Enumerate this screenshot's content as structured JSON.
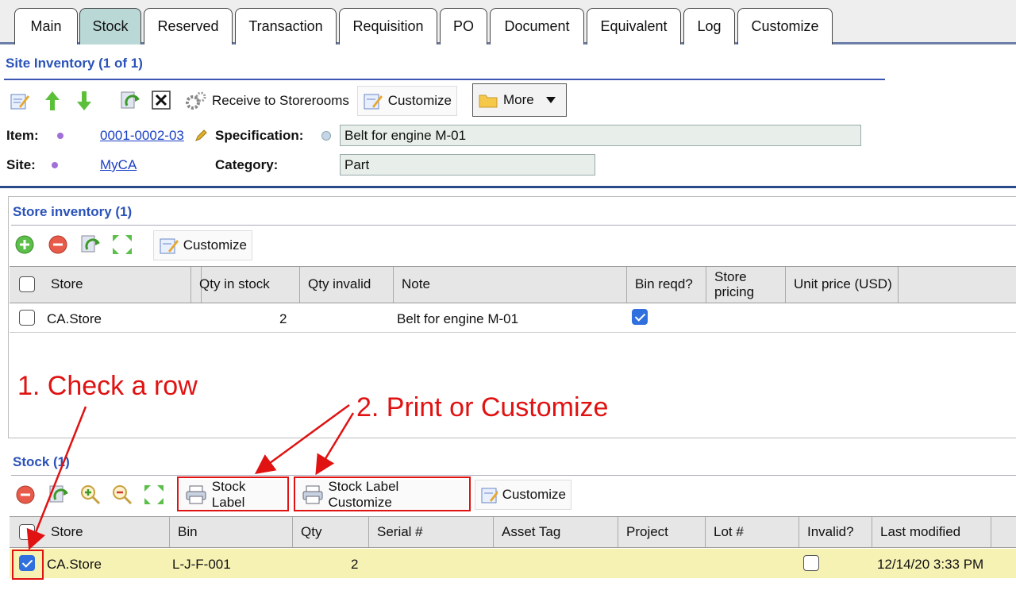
{
  "tabs": [
    "Main",
    "Stock",
    "Reserved",
    "Transaction",
    "Requisition",
    "PO",
    "Document",
    "Equivalent",
    "Log",
    "Customize"
  ],
  "site_inventory": {
    "title": "Site Inventory (1 of 1)",
    "toolbar": {
      "receive_label": "Receive to Storerooms",
      "customize_label": "Customize",
      "more_label": "More"
    },
    "item_label": "Item:",
    "item_value": "0001-0002-03",
    "spec_label": "Specification:",
    "spec_value": "Belt for engine M-01",
    "site_label": "Site:",
    "site_value": "MyCA",
    "category_label": "Category:",
    "category_value": "Part"
  },
  "store_inventory": {
    "title": "Store inventory (1)",
    "customize_label": "Customize",
    "columns": [
      "Store",
      "Qty in stock",
      "Qty invalid",
      "Note",
      "Bin reqd?",
      "Store pricing",
      "Unit price (USD)"
    ],
    "rows": [
      {
        "store": "CA.Store",
        "qty_in_stock": "2",
        "qty_invalid": "",
        "note": "Belt for engine M-01",
        "bin_reqd": true
      }
    ]
  },
  "stock": {
    "title": "Stock (1)",
    "stock_label_btn": "Stock Label",
    "stock_label_customize_btn": "Stock Label Customize",
    "customize_label": "Customize",
    "columns": [
      "Store",
      "Bin",
      "Qty",
      "Serial #",
      "Asset Tag",
      "Project",
      "Lot #",
      "Invalid?",
      "Last modified"
    ],
    "rows": [
      {
        "checked": true,
        "store": "CA.Store",
        "bin": "L-J-F-001",
        "qty": "2",
        "invalid": false,
        "last_modified": "12/14/20 3:33 PM"
      }
    ]
  },
  "annotations": {
    "step1": "1. Check a row",
    "step2": "2. Print or Customize"
  }
}
